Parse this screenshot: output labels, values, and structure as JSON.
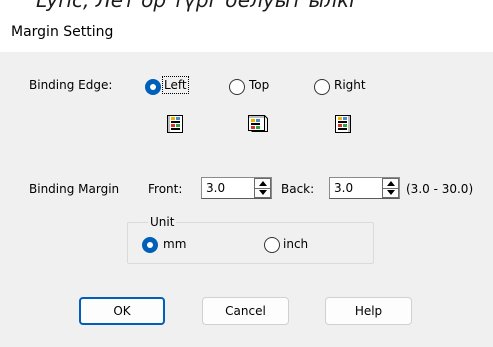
{
  "above_window_text": "Lyric, Лет ор түрг белуыт ылкі",
  "window": {
    "title": "Margin Setting"
  },
  "binding_edge": {
    "label": "Binding Edge:",
    "options": [
      {
        "label": "Left",
        "selected": true,
        "icon": "book-left-binding-icon"
      },
      {
        "label": "Top",
        "selected": false,
        "icon": "book-top-binding-icon"
      },
      {
        "label": "Right",
        "selected": false,
        "icon": "book-right-binding-icon"
      }
    ]
  },
  "binding_margin": {
    "label": "Binding Margin",
    "front_label": "Front:",
    "front_value": "3.0",
    "back_label": "Back:",
    "back_value": "3.0",
    "range_text": "(3.0 - 30.0)"
  },
  "unit": {
    "label": "Unit",
    "options": [
      {
        "label": "mm",
        "selected": true
      },
      {
        "label": "inch",
        "selected": false
      }
    ]
  },
  "buttons": {
    "ok": "OK",
    "cancel": "Cancel",
    "help": "Help"
  },
  "colors": {
    "accent": "#005fb8",
    "client_bg": "#f0f0f0"
  }
}
